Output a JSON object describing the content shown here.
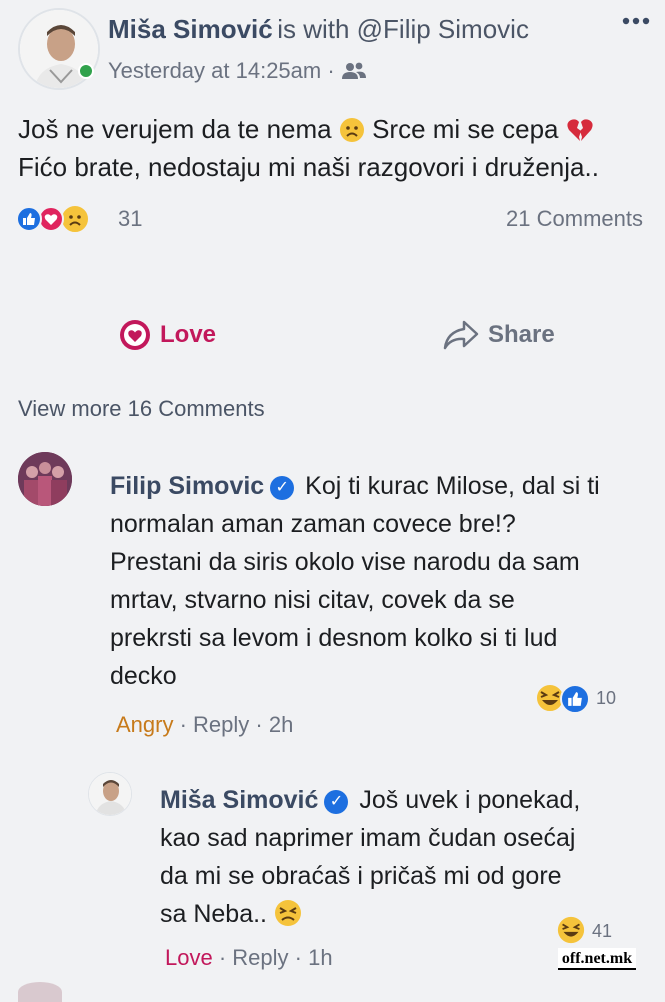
{
  "post": {
    "author": "Miša Simović",
    "with_text": "is with @Filip Simovic",
    "timestamp": "Yesterday at 14:25am",
    "audience_sep": "·",
    "line1": "Još ne verujem da te nema",
    "line1b": "Srce mi se cepa",
    "line2": "Fićo brate, nedostaju mi naši razgovori i druženja..",
    "reaction_count": "31",
    "comments_count": "21 Comments",
    "love_label": "Love",
    "share_label": "Share",
    "view_more": "View more 16 Comments"
  },
  "comments": [
    {
      "author": "Filip Simovic",
      "first_line": "Koj ti kurac Milose, dal si ti",
      "lines": [
        "normalan aman zaman covece bre!?",
        "Prestani da siris okolo vise narodu da sam",
        "mrtav, stvarno nisi citav, covek da se",
        "prekrsti sa levom i desnom kolko si ti lud",
        "decko"
      ],
      "reaction_count": "10",
      "action": "Angry",
      "reply": "Reply",
      "time": "2h"
    },
    {
      "author": "Miša Simović",
      "first_line": "Još uvek i ponekad,",
      "lines": [
        "kao sad naprimer imam čudan osećaj",
        "da mi se obraćaš i pričaš mi od gore",
        "sa Neba.."
      ],
      "reaction_count": "41",
      "action": "Love",
      "reply": "Reply",
      "time": "1h"
    }
  ],
  "watermark": "off.net.mk",
  "colors": {
    "love": "#c2185b",
    "angry": "#c77a1a",
    "like_blue": "#1d6fe0",
    "online_green": "#31a24c"
  },
  "icons": [
    "more-options-icon",
    "friends-icon",
    "sad-face-emoji",
    "broken-heart-emoji",
    "like-reaction-icon",
    "love-reaction-icon",
    "sad-reaction-icon",
    "heart-outline-icon",
    "share-arrow-icon",
    "verified-badge-icon",
    "laugh-reaction-icon",
    "persevere-emoji"
  ]
}
